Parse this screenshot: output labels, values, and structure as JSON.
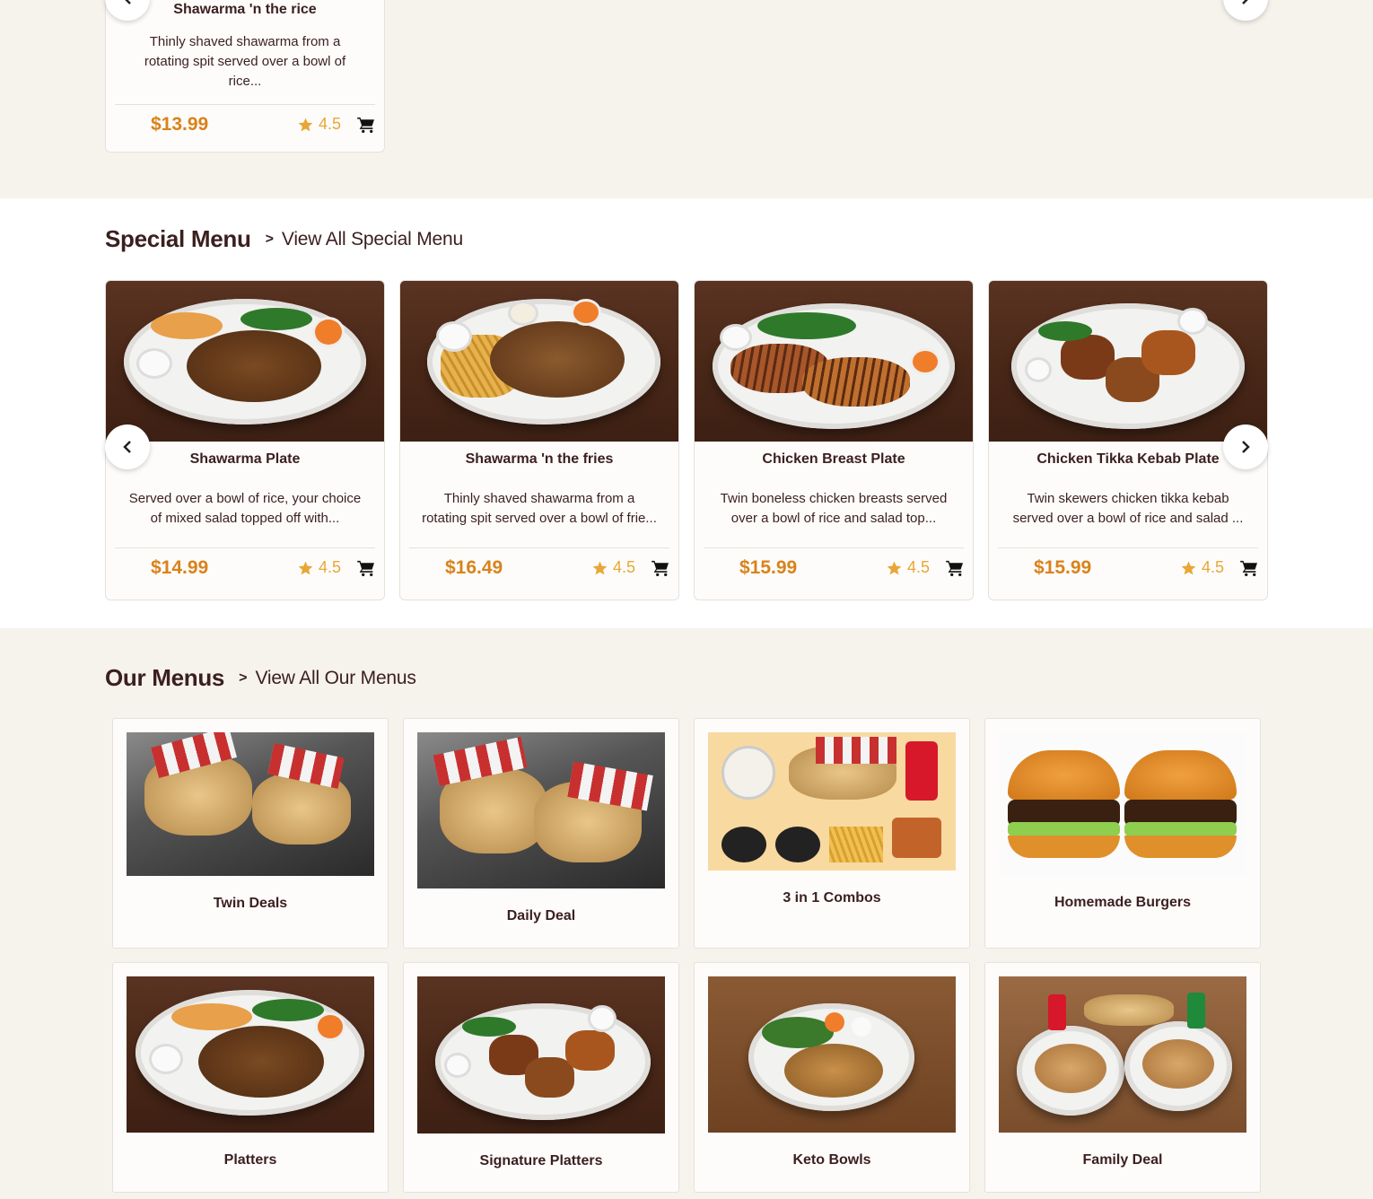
{
  "top_card": {
    "name": "Shawarma 'n the rice",
    "description": "Thinly shaved shawarma from a rotating spit served over a bowl of rice...",
    "price": "$13.99",
    "rating": "4.5"
  },
  "special_menu": {
    "title": "Special Menu",
    "view_all": "View All Special Menu",
    "items": [
      {
        "name": "Shawarma Plate",
        "description": "Served over a bowl of rice, your choice of mixed salad topped off with...",
        "price": "$14.99",
        "rating": "4.5"
      },
      {
        "name": "Shawarma 'n the fries",
        "description": "Thinly shaved shawarma from a rotating spit served over a bowl of frie...",
        "price": "$16.49",
        "rating": "4.5"
      },
      {
        "name": "Chicken Breast Plate",
        "description": "Twin boneless chicken breasts served over a bowl of rice and salad top...",
        "price": "$15.99",
        "rating": "4.5"
      },
      {
        "name": "Chicken Tikka Kebab Plate",
        "description": "Twin skewers chicken tikka kebab served over a bowl of rice and salad ...",
        "price": "$15.99",
        "rating": "4.5"
      }
    ]
  },
  "our_menus": {
    "title": "Our Menus",
    "view_all": "View All Our Menus",
    "categories": [
      {
        "label": "Twin Deals"
      },
      {
        "label": "Daily Deal"
      },
      {
        "label": "3 in 1 Combos"
      },
      {
        "label": "Homemade Burgers"
      },
      {
        "label": "Platters"
      },
      {
        "label": "Signature Platters"
      },
      {
        "label": "Keto Bowls"
      },
      {
        "label": "Family Deal"
      }
    ]
  },
  "colors": {
    "accent_price": "#d9821a",
    "rating_star": "#e8a735",
    "text_dark": "#3b1f1f",
    "section_bg": "#f6f2ec"
  },
  "icons": [
    "chevron-left-icon",
    "chevron-right-icon",
    "star-icon",
    "cart-icon"
  ]
}
